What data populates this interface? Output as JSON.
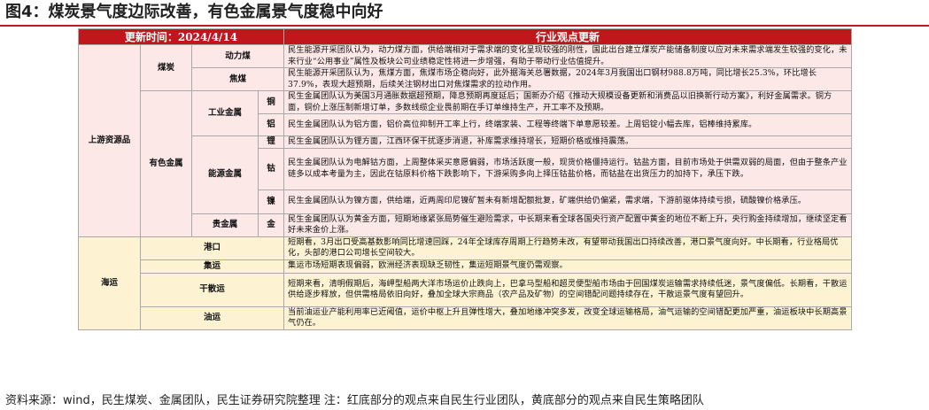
{
  "title": "图4：煤炭景气度边际改善，有色金属景气度稳中向好",
  "table": {
    "update_time": "更新时间：2024/4/14",
    "view_header": "行业观点更新",
    "upstream_label": "上游资源品",
    "coal_label": "煤炭",
    "thermal_coal": "动力煤",
    "thermal_coal_view": "民生能源开采团队认为，动力煤方面，供给端相对于需求端的变化呈现较强的刚性，国此出台建立煤炭产能储备制度以应对未来需求端发生较强的变化，未来行业“公用事业”属性及板块公司业绩稳定性将进一步增强，有助于带动行业估值提升。",
    "coking_coal": "焦煤",
    "coking_coal_view": "民生能源开采团队认为，焦煤方面，焦煤市场企稳向好，此外据海关总署数据，2024年3月我国出口钢材988.8万吨，同比增长25.3%，环比增长37.9%，表现大超预期，后续关注钢材出口对焦煤需求的拉动作用。",
    "nonferrous_label": "有色金属",
    "industrial_metals": "工业金属",
    "copper": "铜",
    "copper_view": "民生金属团队认为美国3月通胀数据超预期，降息预期再度延后；国新办介绍《推动大规模设备更新和消费品以旧换新行动方案》，利好金属需求。铜方面，铜价上涨压制新增订单，多数线缆企业畏前期在手订单维持生产，开工率不及预期。",
    "aluminum": "铝",
    "aluminum_view": "民生金属团队认为铝方面，铝价高位抑制开工率上行，终端家装、工程等终端下单意愿较差。上周铝锭小幅去库，铝棒维持累库。",
    "energy_metals": "能源金属",
    "lithium": "锂",
    "lithium_view": "民生金属团队认为锂方面，江西环保干扰逐步消退，补库需求维持增长，短期价格或维持震荡。",
    "cobalt": "钴",
    "cobalt_view": "民生金属团队认为电解钴方面，上周整体采买意愿偏弱，市场活跃度一般，现货价格僵持运行。钴盐方面，目前市场处于供需双弱的局面，但由于整条产业链多以成本考量为主，因此在钴原料价格下跌影响下，下游采购多向上择压钴盐价格，而钴盐在出货压力的加持下，承压下跌。",
    "nickel": "镍",
    "nickel_view": "民生金属团队认为镍方面，供给端，近两周印尼镍矿暂未有新增配额批复，矿端供给仍偏紧，需求端，下游前驱体持续亏损，硫酸镍价格承压。",
    "precious_metals": "贵金属",
    "gold": "金",
    "gold_view": "民生金属团队认为黄金方面，短期地缘紧张局势催生避险需求，中长期来看全球各国央行资产配置中黄金的地位不断上升，央行购金持续增加，继续坚定看好未来金价上涨。",
    "shipping_label": "海运",
    "port": "港口",
    "port_view": "短期看，3月出口受高基数影响同比增速回踩，24年全球库存周期上行趋势未改，有望带动我国出口持续改善，港口景气度向好。中长期看，行业格局优化，头部的港口公司增长空间较大。",
    "container": "集运",
    "container_view": "集运市场短期表现偏弱，欧洲经济表现缺乏韧性，集运短期景气度仍需观察。",
    "dry_bulk": "干散运",
    "dry_bulk_view": "短期来看，清明假期后，海岬型船两大洋市场运价止跌向上，巴拿马型船和超灵便型船市场由于回国煤炭运输需求持续低迷，景气度偏低。长期看，干散运供给逐步释放，但供需格局依旧向好，叠加全球大宗商品（农产品及矿物）的空间错配问题持续存在，干散运景气度有望回升。",
    "tanker": "油运",
    "tanker_view": "当前油运业产能利用率已近阈值，运价中枢上升且弹性增大，叠加地缘冲突多发，改变全球运输格局，油气运输的空间错配更加严重，油运板块中长期高景气仍在。"
  },
  "source": "资料来源：wind，民生煤炭、金属团队，民生证券研究院整理 注：红底部分的观点来自民生行业团队，黄底部分的观点来自民生策略团队",
  "colors": {
    "header_red": "#c0161c",
    "upstream_pink": "#fde8e8",
    "shipping_yellow": "#fdf3d3",
    "title_rule": "#c4161c"
  }
}
